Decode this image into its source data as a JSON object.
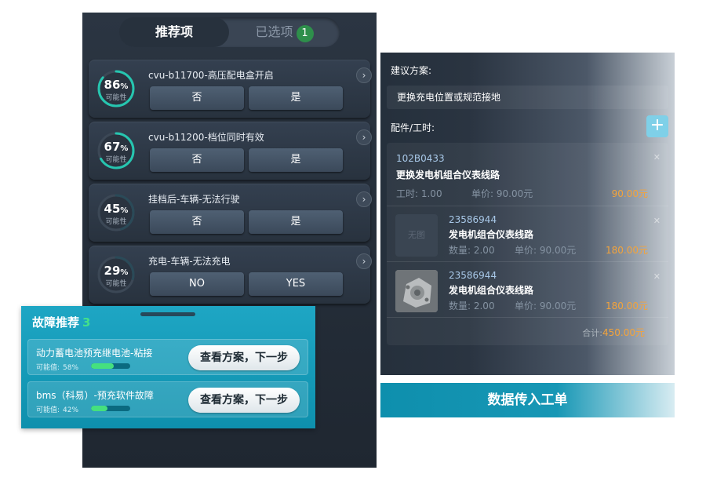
{
  "tabs": {
    "recommended": "推荐项",
    "selected": "已选项",
    "selected_count": "1"
  },
  "recommendations": [
    {
      "title": "cvu-b11700-高压配电盒开启",
      "percent": "86",
      "percent_value": 86,
      "unit": "%",
      "caption": "可能性",
      "no": "否",
      "yes": "是"
    },
    {
      "title": "cvu-b11200-档位同时有效",
      "percent": "67",
      "percent_value": 67,
      "unit": "%",
      "caption": "可能性",
      "no": "否",
      "yes": "是"
    },
    {
      "title": "挂档后-车辆-无法行驶",
      "percent": "45",
      "percent_value": 45,
      "unit": "%",
      "caption": "可能性",
      "no": "否",
      "yes": "是"
    },
    {
      "title": "充电-车辆-无法充电",
      "percent": "29",
      "percent_value": 29,
      "unit": "%",
      "caption": "可能性",
      "no": "NO",
      "yes": "YES"
    }
  ],
  "fault": {
    "title": "故障推荐",
    "count": "3",
    "items": [
      {
        "name": "动力蓄电池预充继电池-粘接",
        "prob_label": "可能值:",
        "prob": "58%",
        "prob_value": 58,
        "action": "查看方案，下一步"
      },
      {
        "name": "bms（科易）-预充软件故障",
        "prob_label": "可能值:",
        "prob": "42%",
        "prob_value": 42,
        "action": "查看方案，下一步"
      }
    ]
  },
  "plan": {
    "suggestion_label": "建议方案:",
    "suggestion": "更换充电位置或规范接地",
    "parts_label": "配件/工时:",
    "add_icon": "plus-icon",
    "parts": [
      {
        "code": "102B0433",
        "name": "更换发电机组合仪表线路",
        "qty_label": "工时: 1.00",
        "price_label": "单价: 90.00元",
        "amount": "90.00元"
      },
      {
        "code": "23586944",
        "name": "发电机组合仪表线路",
        "thumb": "无图",
        "qty_label": "数量: 2.00",
        "price_label": "单价: 90.00元",
        "amount": "180.00元"
      },
      {
        "code": "23586944",
        "name": "发电机组合仪表线路",
        "qty_label": "数量: 2.00",
        "price_label": "单价: 90.00元",
        "amount": "180.00元"
      }
    ],
    "total_label": "合计:",
    "total": "450.00元"
  },
  "submit_label": "数据传入工单",
  "colors": {
    "ring": "#26c6b0",
    "accent_green": "#44e08a",
    "amount": "#f3a33b",
    "fault_bg": "#1ea6c4"
  }
}
